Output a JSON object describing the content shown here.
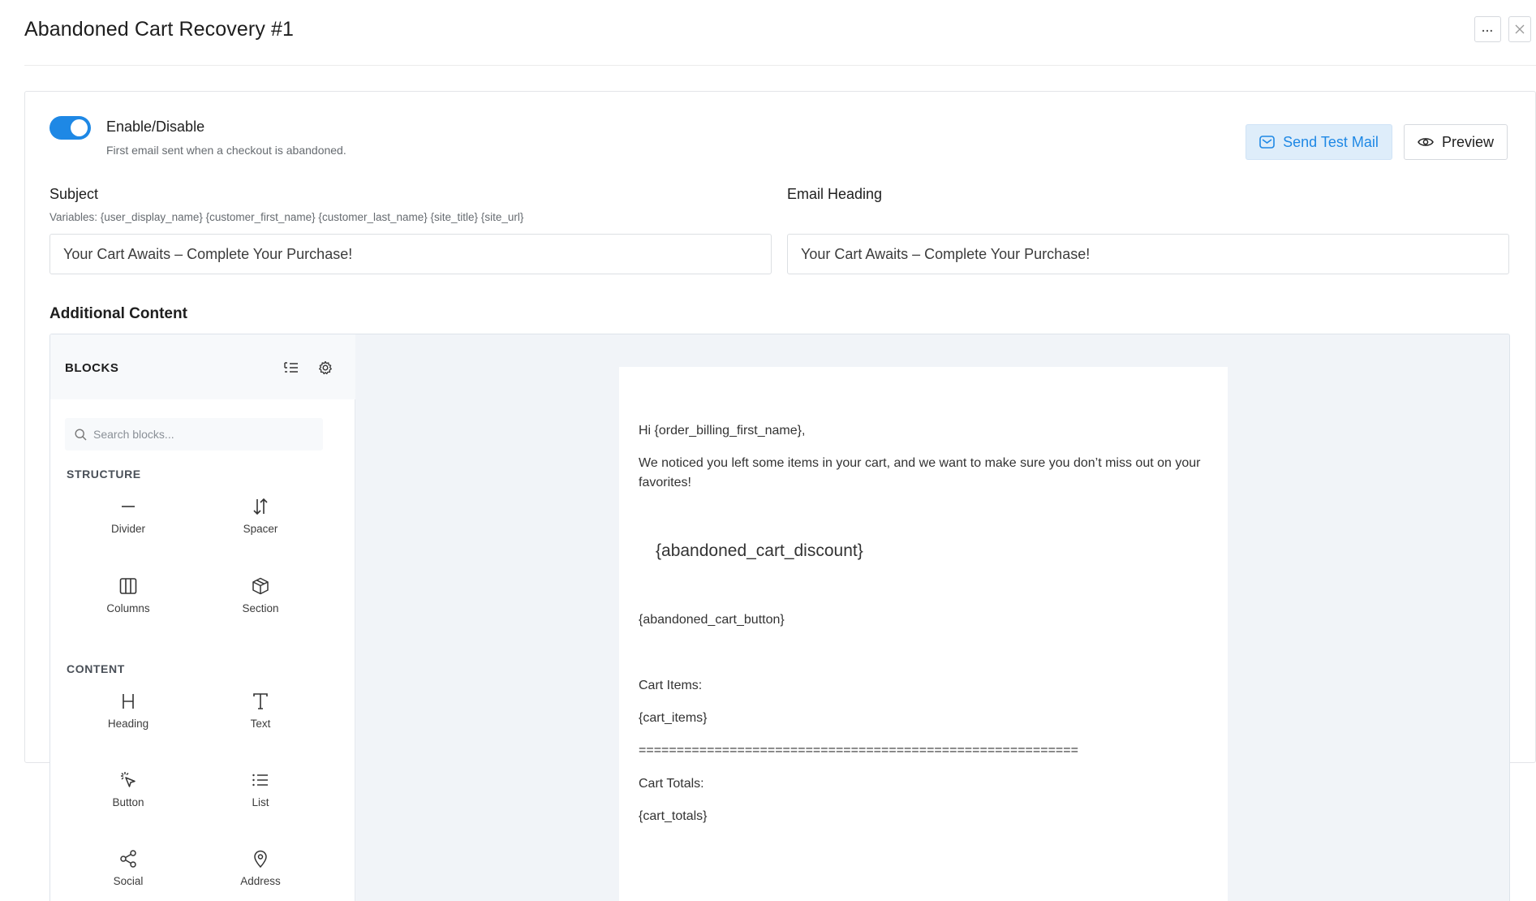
{
  "header": {
    "title": "Abandoned Cart Recovery #1",
    "more_icon": "ellipsis-icon",
    "close_icon": "close-icon"
  },
  "colors": {
    "accent": "#1e88e5",
    "accent_light": "#deedfa",
    "canvas_bg": "#f1f4f8"
  },
  "settings": {
    "toggle_on": true,
    "enable_label": "Enable/Disable",
    "enable_description": "First email sent when a checkout is abandoned.",
    "send_test_label": "Send Test Mail",
    "preview_label": "Preview",
    "subject_label": "Subject",
    "subject_variables": "Variables: {user_display_name} {customer_first_name} {customer_last_name} {site_title} {site_url}",
    "subject_value": "Your Cart Awaits – Complete Your Purchase!",
    "heading_label": "Email Heading",
    "heading_value": "Your Cart Awaits – Complete Your Purchase!",
    "additional_content_label": "Additional Content"
  },
  "blocks_panel": {
    "title": "BLOCKS",
    "search_placeholder": "Search blocks...",
    "structure_label": "STRUCTURE",
    "content_label": "CONTENT",
    "structure": [
      {
        "label": "Divider",
        "icon": "divider-icon"
      },
      {
        "label": "Spacer",
        "icon": "spacer-icon"
      },
      {
        "label": "Columns",
        "icon": "columns-icon"
      },
      {
        "label": "Section",
        "icon": "section-icon"
      }
    ],
    "content": [
      {
        "label": "Heading",
        "icon": "heading-icon"
      },
      {
        "label": "Text",
        "icon": "text-icon"
      },
      {
        "label": "Button",
        "icon": "button-icon"
      },
      {
        "label": "List",
        "icon": "list-icon"
      },
      {
        "label": "Social",
        "icon": "social-icon"
      },
      {
        "label": "Address",
        "icon": "address-icon"
      }
    ]
  },
  "email": {
    "greeting": "Hi {order_billing_first_name},",
    "intro": "We noticed you left some items in your cart, and we want to make sure you don’t miss out on your favorites!",
    "discount": "{abandoned_cart_discount}",
    "button": "{abandoned_cart_button}",
    "cart_items_label": "Cart Items:",
    "cart_items": "{cart_items}",
    "separator": "==========================================================",
    "cart_totals_label": "Cart Totals:",
    "cart_totals": "{cart_totals}"
  }
}
